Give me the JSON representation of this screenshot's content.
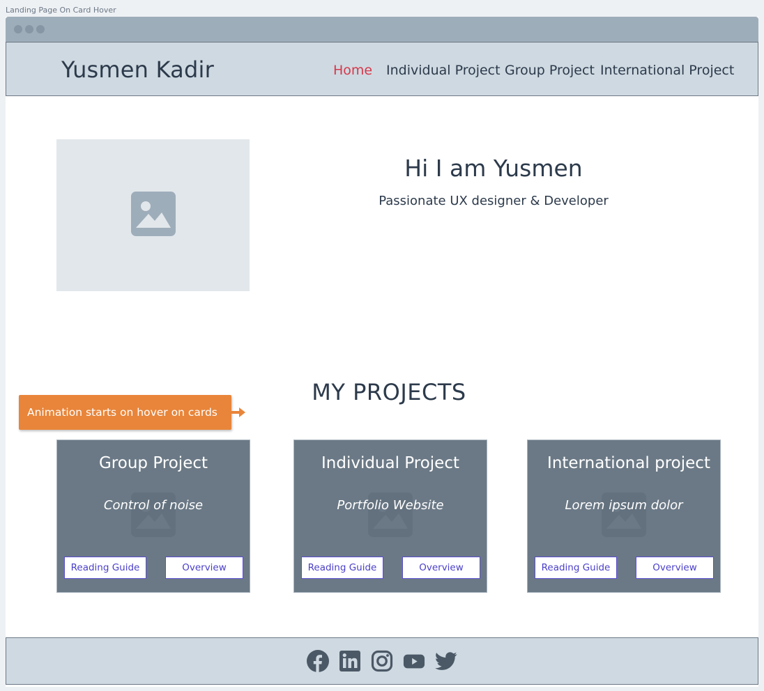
{
  "frame": {
    "title": "Landing Page On Card Hover"
  },
  "header": {
    "brand": "Yusmen Kadir",
    "nav": [
      {
        "label": "Home",
        "active": true
      },
      {
        "label": "Individual Project"
      },
      {
        "label": "Group Project"
      },
      {
        "label": "International Project"
      }
    ]
  },
  "hero": {
    "image_icon": "image-placeholder-icon",
    "title": "Hi I am Yusmen",
    "subtitle": "Passionate UX designer & Developer"
  },
  "projects": {
    "title": "MY PROJECTS",
    "annotation": "Animation starts on hover on cards",
    "cards": [
      {
        "title": "Group Project",
        "subtitle": "Control of noise",
        "button_left": "Reading Guide",
        "button_right": "Overview"
      },
      {
        "title": "Individual Project",
        "subtitle": "Portfolio Website",
        "button_left": "Reading Guide",
        "button_right": "Overview"
      },
      {
        "title": "International project",
        "subtitle": "Lorem ipsum dolor",
        "button_left": "Reading Guide",
        "button_right": "Overview"
      }
    ]
  },
  "footer": {
    "social_icons": [
      "facebook-icon",
      "linkedin-icon",
      "instagram-icon",
      "youtube-icon",
      "twitter-icon"
    ]
  },
  "colors": {
    "accent": "#d6384b",
    "annotation": "#e8853a",
    "card": "#6b7986",
    "navbar": "#cfd9e1",
    "button_text": "#4a3fc8"
  }
}
